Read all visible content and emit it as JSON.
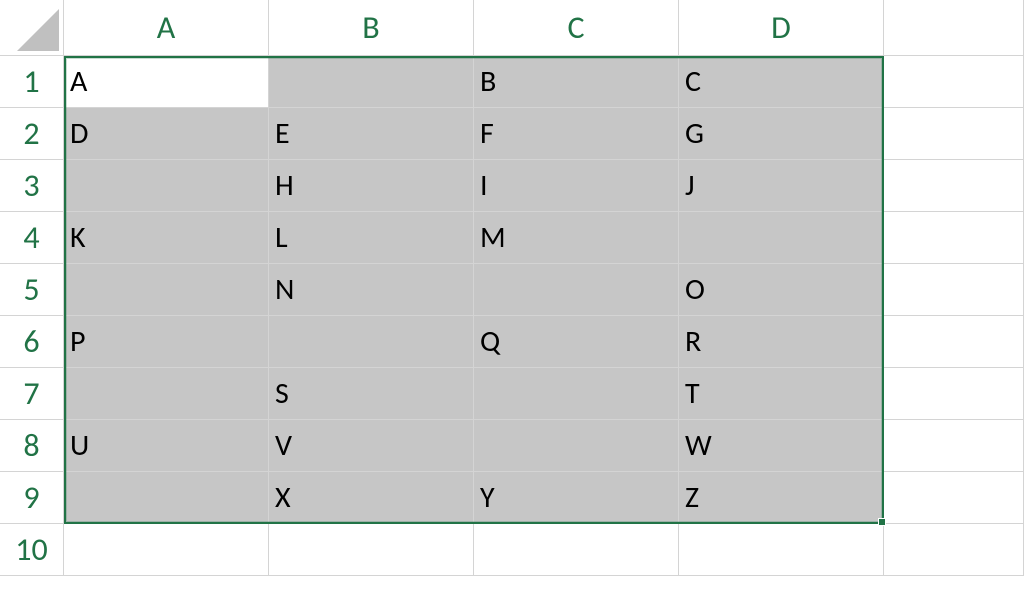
{
  "columns": [
    "A",
    "B",
    "C",
    "D"
  ],
  "row_numbers": [
    "1",
    "2",
    "3",
    "4",
    "5",
    "6",
    "7",
    "8",
    "9",
    "10"
  ],
  "cells": {
    "A1": "A",
    "B1": "",
    "C1": "B",
    "D1": "C",
    "A2": "D",
    "B2": "E",
    "C2": "F",
    "D2": "G",
    "A3": "",
    "B3": "H",
    "C3": "I",
    "D3": "J",
    "A4": "K",
    "B4": "L",
    "C4": "M",
    "D4": "",
    "A5": "",
    "B5": "N",
    "C5": "",
    "D5": "O",
    "A6": "P",
    "B6": "",
    "C6": "Q",
    "D6": "R",
    "A7": "",
    "B7": "S",
    "C7": "",
    "D7": "T",
    "A8": "U",
    "B8": "V",
    "C8": "",
    "D8": "W",
    "A9": "",
    "B9": "X",
    "C9": "Y",
    "D9": "Z",
    "A10": "",
    "B10": "",
    "C10": "",
    "D10": ""
  },
  "selection": {
    "start": "A1",
    "end": "D9",
    "active": "A1"
  },
  "colors": {
    "accent": "#217346",
    "selection_fill": "#c6c6c6",
    "grid": "#d4d4d4"
  }
}
